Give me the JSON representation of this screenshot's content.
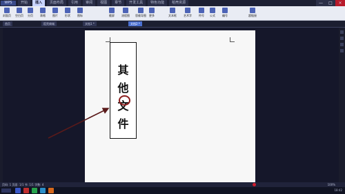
{
  "app": {
    "logo": "WPS"
  },
  "menu": {
    "tabs": [
      "开始",
      "插入",
      "页面布局",
      "引用",
      "审阅",
      "视图",
      "章节",
      "开发工具",
      "特色功能",
      "稻壳资源"
    ],
    "active_index": 1
  },
  "window": {
    "minimize": "—",
    "maximize": "□",
    "close": "×"
  },
  "ribbon": {
    "groups": [
      "封面页",
      "空白页",
      "分页",
      "表格",
      "图片",
      "形状",
      "图标",
      "截屏",
      "流程图",
      "思维导图",
      "更多",
      "文本框",
      "艺术字",
      "符号",
      "公式",
      "编号",
      "超链接"
    ]
  },
  "tabs": [
    {
      "label": "首页"
    },
    {
      "label": "稻壳商城"
    },
    {
      "label": "文档1 *"
    },
    {
      "label": "文档2 *",
      "active": true
    }
  ],
  "document": {
    "chars": [
      "其",
      "他",
      "文",
      "件"
    ]
  },
  "status": {
    "left": "页码: 1  页面: 1/1  节: 1/1  字数: 4",
    "zoom": "100%"
  },
  "taskbar": {
    "tray": "18:42"
  },
  "colors": {
    "accent": "#4a6fd0",
    "circle": "#8b1a1a",
    "arrow": "#5a1a1a"
  }
}
